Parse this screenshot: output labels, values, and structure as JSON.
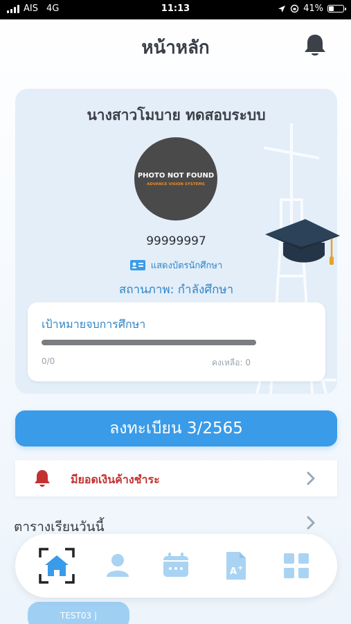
{
  "status_bar": {
    "carrier": "AIS",
    "network": "4G",
    "time": "11:13",
    "battery": "41%",
    "battery_level": 0.41
  },
  "header": {
    "title": "หน้าหลัก",
    "bell_icon": "bell-icon"
  },
  "profile": {
    "name": "นางสาวโมบาย ทดสอบระบบ",
    "photo_text_1": "PHOTO NOT FOUND",
    "photo_text_2": "ADVANCE VISION SYSTEMS",
    "student_id": "99999997",
    "show_card_label": "แสดงบัตรนักศึกษา",
    "status": "สถานภาพ: กำลังศึกษา"
  },
  "goal": {
    "title": "เป้าหมายจบการศึกษา",
    "progress_text": "0/0",
    "remaining_text": "คงเหลือ: 0",
    "progress": 0
  },
  "register": {
    "label": "ลงทะเบียน 3/2565"
  },
  "alert": {
    "label": "มียอดเงินค้างชำระ"
  },
  "schedule": {
    "title": "ตารางเรียนวันนี้",
    "chip_label": "TEST03 |"
  },
  "nav": {
    "items": [
      "home-icon",
      "profile-icon",
      "calendar-icon",
      "grade-document-icon",
      "grid-menu-icon"
    ],
    "active": 0
  },
  "colors": {
    "accent": "#3a9be8",
    "alert": "#c43131",
    "text_primary": "#3b3f47",
    "link": "#2f86c6"
  }
}
